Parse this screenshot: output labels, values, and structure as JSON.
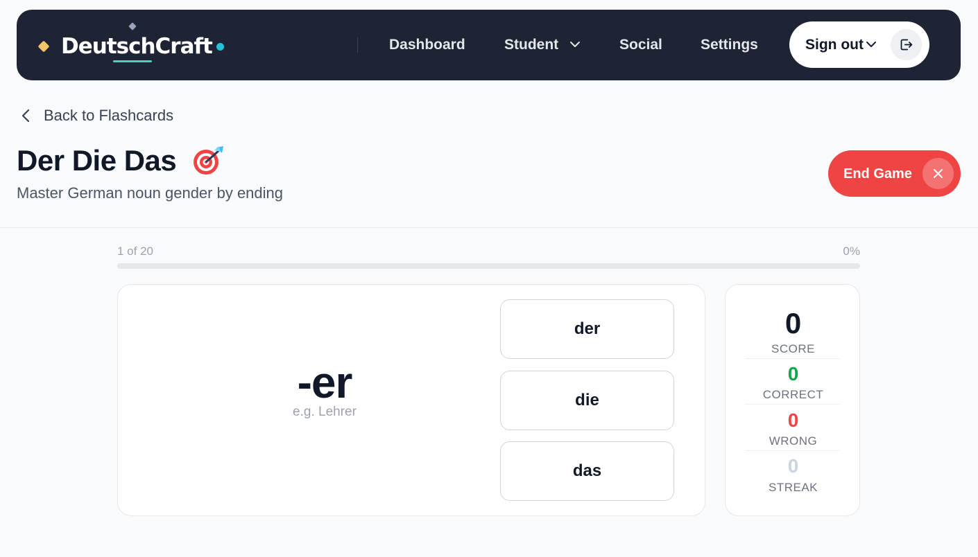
{
  "app": {
    "name": "DeutschCraft"
  },
  "nav": {
    "items": [
      {
        "label": "Dashboard"
      },
      {
        "label": "Student"
      },
      {
        "label": "Social"
      },
      {
        "label": "Settings"
      }
    ],
    "sign_out_label": "Sign out"
  },
  "header": {
    "back_label": "Back to Flashcards",
    "title": "Der Die Das",
    "title_icon": "target-dart-icon",
    "subtitle": "Master German noun gender by ending",
    "end_game_label": "End Game"
  },
  "progress": {
    "position_text": "1 of 20",
    "percent_text": "0%",
    "fraction": 0
  },
  "card": {
    "ending": "-er",
    "example": "e.g. Lehrer",
    "choices": [
      "der",
      "die",
      "das"
    ]
  },
  "stats": {
    "score": {
      "value": "0",
      "label": "SCORE"
    },
    "correct": {
      "value": "0",
      "label": "CORRECT"
    },
    "wrong": {
      "value": "0",
      "label": "WRONG"
    },
    "streak": {
      "value": "0",
      "label": "STREAK"
    }
  },
  "colors": {
    "nav_background": "#1e2433",
    "accent_teal": "#22c3d6",
    "logo_gold": "#f6c46a",
    "end_game_red": "#ef4444",
    "correct_green": "#16a34a",
    "wrong_red": "#ef4444",
    "streak_gray": "#cbd5e1"
  }
}
